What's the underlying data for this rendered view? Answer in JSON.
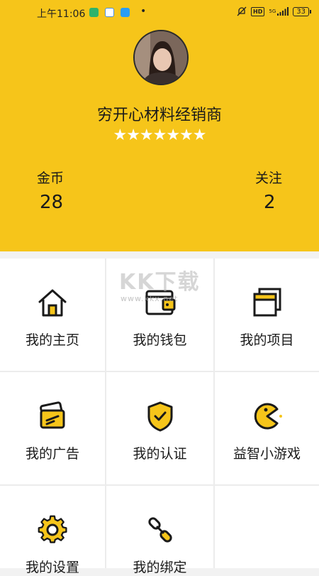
{
  "status_bar": {
    "time": "上午11:06",
    "dot": "•",
    "network": "5G",
    "hd": "HD",
    "battery": "33"
  },
  "profile": {
    "name": "穷开心材料经销商",
    "stars": "★★★★★★★",
    "stats": [
      {
        "label": "金币",
        "value": "28"
      },
      {
        "label": "关注",
        "value": "2"
      }
    ]
  },
  "menu": [
    {
      "label": "我的主页",
      "icon": "home-icon"
    },
    {
      "label": "我的钱包",
      "icon": "wallet-icon"
    },
    {
      "label": "我的项目",
      "icon": "projects-icon"
    },
    {
      "label": "我的广告",
      "icon": "ad-card-icon"
    },
    {
      "label": "我的认证",
      "icon": "shield-check-icon"
    },
    {
      "label": "益智小游戏",
      "icon": "pacman-icon"
    },
    {
      "label": "我的设置",
      "icon": "gear-icon"
    },
    {
      "label": "我的绑定",
      "icon": "link-icon"
    }
  ],
  "watermark": {
    "text": "KK下载",
    "sub": "www.kkx.net"
  },
  "colors": {
    "header": "#f6c51a",
    "accent": "#f6c51a",
    "icon_stroke": "#1a1a1a"
  }
}
